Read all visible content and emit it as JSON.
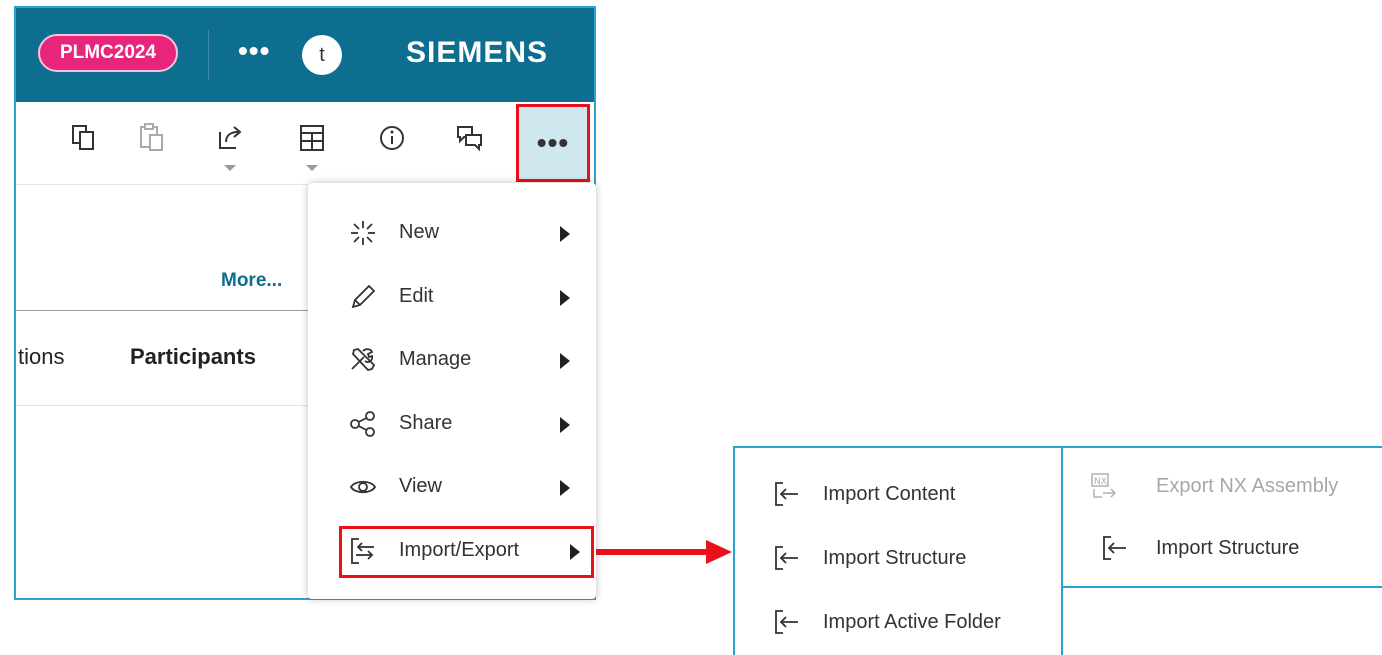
{
  "header": {
    "project_badge": "PLMC2024",
    "more_icon": "•••",
    "avatar_initial": "t",
    "brand": "SIEMENS"
  },
  "toolbar": {
    "buttons": [
      {
        "icon": "copy-icon"
      },
      {
        "icon": "paste-icon"
      },
      {
        "icon": "share-out-icon",
        "has_dropdown": true
      },
      {
        "icon": "layout-icon",
        "has_dropdown": true
      },
      {
        "icon": "info-icon"
      },
      {
        "icon": "comments-icon"
      }
    ],
    "more_label": "•••"
  },
  "content": {
    "more_link": "More...",
    "tab_partial": "tions",
    "tab_participants": "Participants"
  },
  "menu": {
    "items": [
      {
        "label": "New",
        "icon": "new-sparkle-icon"
      },
      {
        "label": "Edit",
        "icon": "pencil-icon"
      },
      {
        "label": "Manage",
        "icon": "tools-icon"
      },
      {
        "label": "Share",
        "icon": "share-nodes-icon"
      },
      {
        "label": "View",
        "icon": "eye-icon"
      },
      {
        "label": "Import/Export",
        "icon": "import-export-icon"
      }
    ]
  },
  "submenu_import": {
    "items": [
      {
        "label": "Import Content",
        "icon": "import-icon"
      },
      {
        "label": "Import Structure",
        "icon": "import-icon"
      },
      {
        "label": "Import Active Folder",
        "icon": "import-icon"
      }
    ]
  },
  "submenu_export": {
    "items": [
      {
        "label": "Export NX Assembly",
        "icon": "nx-export-icon",
        "disabled": true
      },
      {
        "label": "Import Structure",
        "icon": "import-icon"
      }
    ]
  },
  "colors": {
    "header_bg": "#0d6e8f",
    "badge_bg": "#e6257b",
    "accent_border": "#27a3cf",
    "highlight_red": "#e8101a"
  }
}
